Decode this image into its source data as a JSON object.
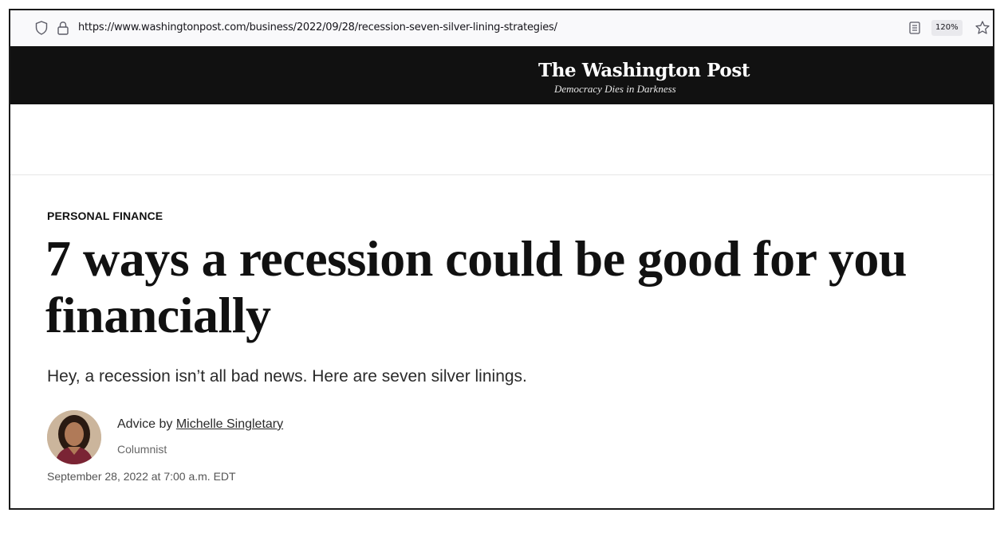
{
  "browser": {
    "url": "https://www.washingtonpost.com/business/2022/09/28/recession-seven-silver-lining-strategies/",
    "zoom": "120%",
    "icons": [
      "shield-icon",
      "lock-icon",
      "reader-view-icon",
      "bookmark-star-icon"
    ]
  },
  "masthead": {
    "logo": "The Washington Post",
    "tagline": "Democracy Dies in Darkness"
  },
  "article": {
    "kicker": "PERSONAL FINANCE",
    "headline": "7 ways a recession could be good for you financially",
    "dek": "Hey, a recession isn’t all bad news. Here are seven silver linings.",
    "byline_prefix": "Advice by",
    "author": "Michelle Singletary",
    "author_role": "Columnist",
    "date": "September 28, 2022 at 7:00 a.m. EDT"
  },
  "colors": {
    "masthead_bg": "#111111",
    "text": "#111111",
    "urlbar_bg": "#f9f9fb"
  }
}
